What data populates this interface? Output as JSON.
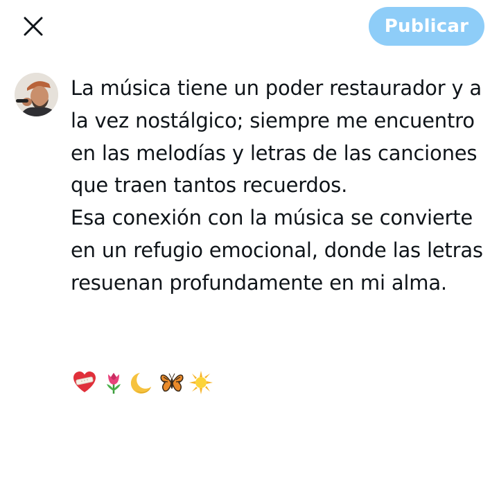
{
  "header": {
    "close_icon": "close-icon",
    "publish_label": "Publicar",
    "publish_color": "#8ecdf8"
  },
  "composer": {
    "avatar_icon": "user-avatar",
    "paragraph_1": "La música tiene un poder restaurador y a la vez nostálgico; siempre me encuentro en las melodías y letras de las canciones que traen tantos recuerdos.",
    "paragraph_2": "Esa conexión con la música se convierte en un refugio emocional, donde las letras resuenan profundamente en mi alma.",
    "emojis": [
      "heart-with-bandage-icon",
      "tulip-icon",
      "crescent-moon-icon",
      "butterfly-icon",
      "sun-icon"
    ]
  }
}
